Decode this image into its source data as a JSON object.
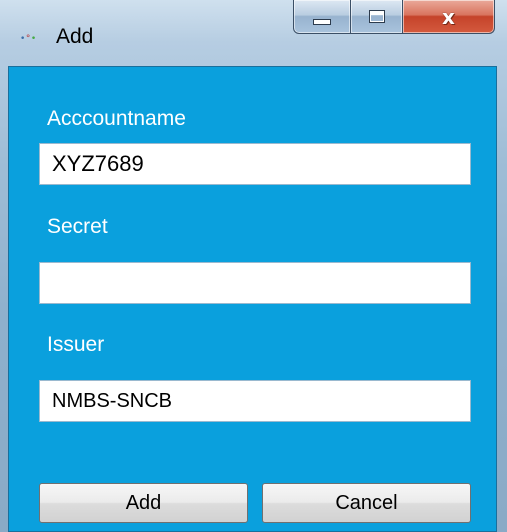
{
  "window": {
    "title": "Add",
    "icon": "app-key-icon",
    "caption": {
      "minimize_glyph": "minimize-icon",
      "maximize_glyph": "maximize-icon",
      "close_glyph": "x"
    }
  },
  "form": {
    "account": {
      "label": "Acccountname",
      "value": "XYZ7689"
    },
    "secret": {
      "label": "Secret",
      "value": ""
    },
    "issuer": {
      "label": "Issuer",
      "value": "NMBS-SNCB"
    }
  },
  "buttons": {
    "add_label": "Add",
    "cancel_label": "Cancel"
  },
  "colors": {
    "client_background": "#0aa0dd",
    "close_button": "#c5432a"
  }
}
